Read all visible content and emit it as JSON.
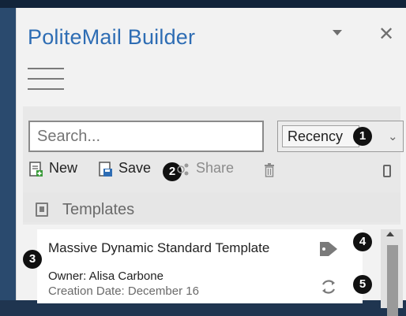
{
  "app": {
    "title": "PoliteMail Builder"
  },
  "window": {
    "minimize_icon": "chevron-down-icon",
    "close_icon": "close-icon",
    "close_glyph": "✕"
  },
  "search": {
    "placeholder": "Search...",
    "value": ""
  },
  "sort": {
    "selected": "Recency",
    "chevron": "⌄"
  },
  "callouts": [
    "1",
    "2",
    "3",
    "4",
    "5"
  ],
  "toolbar": {
    "new_label": "New",
    "save_label": "Save",
    "share_label": "Share",
    "delete_icon": "trash-icon",
    "mobile_icon": "mobile-icon"
  },
  "templates": {
    "section_label": "Templates",
    "items": [
      {
        "title": "Massive Dynamic Standard Template",
        "owner": "Owner: Alisa Carbone",
        "creation_date": "Creation Date: December 16",
        "tag_icon": "tag-icon",
        "sync_icon": "sync-icon"
      }
    ]
  },
  "colors": {
    "title": "#2e6db4",
    "background_dark": "#1f3550",
    "panel": "#f2f2f2"
  }
}
